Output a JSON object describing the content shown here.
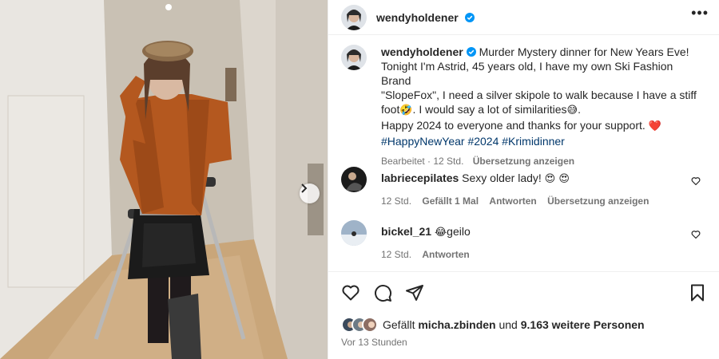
{
  "post": {
    "author": "wendyholdener",
    "caption_lines": [
      "Murder Mystery dinner for New Years Eve!",
      "Tonight I'm Astrid, 45 years old, I have my own Ski Fashion Brand",
      "\"SlopeFox\", I need a silver skipole to walk because I have a stiff",
      "foot",
      "🤣",
      ". I would say a lot of similarities",
      "😅",
      ".",
      "Happy 2024 to everyone and thanks for your support.",
      "❤️"
    ],
    "hashtags": "#HappyNewYear #2024 #Krimidinner",
    "edited": "Bearbeitet",
    "age": "12 Std.",
    "translate": "Übersetzung anzeigen"
  },
  "comments": [
    {
      "user": "labriecepilates",
      "text": "Sexy older lady!",
      "emojis": "😍 😍",
      "age": "12 Std.",
      "likes": "Gefällt 1 Mal",
      "reply": "Antworten",
      "translate": "Übersetzung anzeigen"
    },
    {
      "user": "bickel_21",
      "emojis": "😂",
      "text": "geilo",
      "age": "12 Std.",
      "reply": "Antworten"
    }
  ],
  "likes": {
    "prefix": "Gefällt",
    "user": "micha.zbinden",
    "and": "und",
    "count": "9.163 weitere Personen"
  },
  "timestamp": "Vor 13 Stunden",
  "icons": {
    "verified": "verified-badge-icon",
    "more": "more-options-icon",
    "next": "chevron-right-icon",
    "like": "heart-icon",
    "comment": "comment-bubble-icon",
    "share": "paper-plane-icon",
    "save": "bookmark-icon"
  },
  "colors": {
    "verified": "#0095f6",
    "heart": "#ed4956",
    "hashtag": "#00376b"
  }
}
